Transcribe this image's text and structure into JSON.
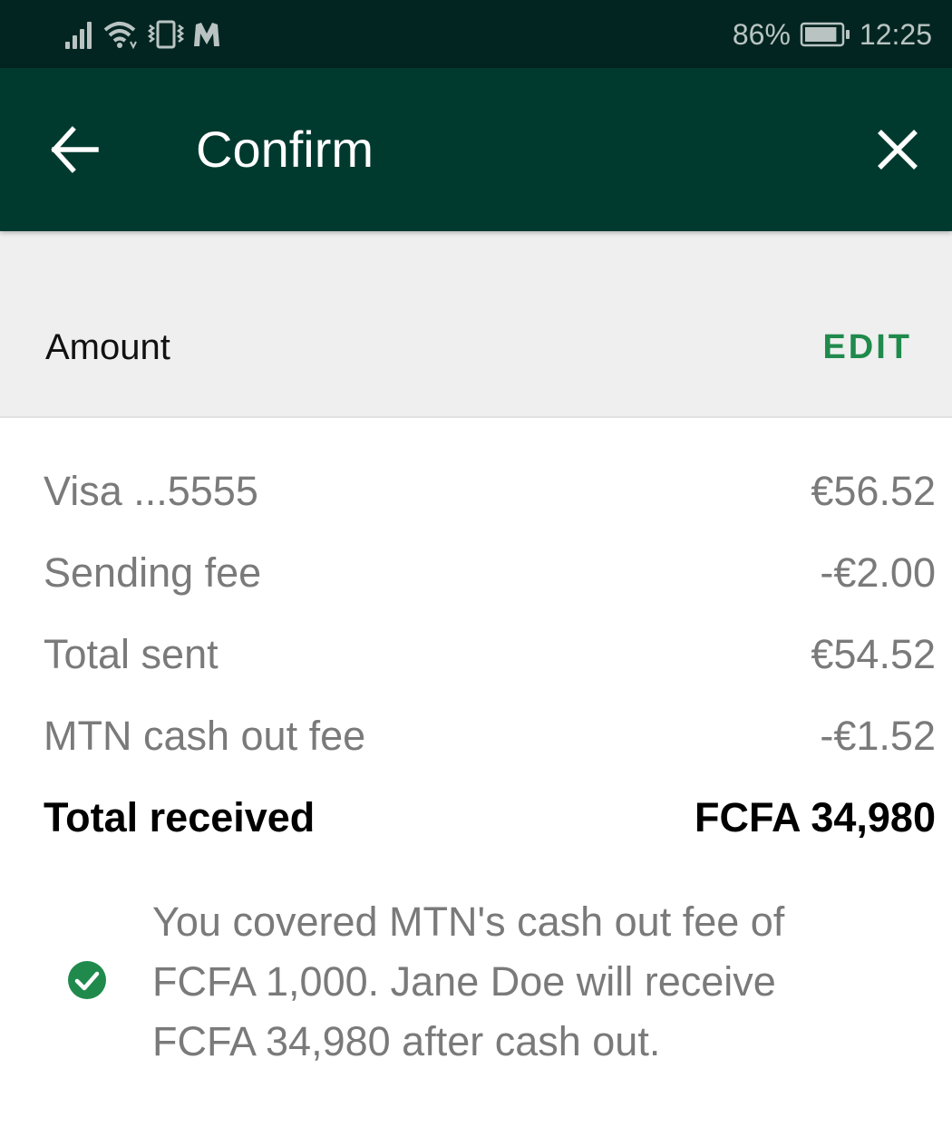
{
  "status_bar": {
    "icons": [
      "signal-icon",
      "wifi-icon",
      "vibrate-icon",
      "m-app-icon"
    ],
    "battery_percent": "86%",
    "battery_level": 0.86,
    "time": "12:25"
  },
  "app_bar": {
    "back_icon": "arrow-left-icon",
    "title": "Confirm",
    "close_icon": "close-icon"
  },
  "amount_section": {
    "label": "Amount",
    "edit_label": "EDIT"
  },
  "breakdown": [
    {
      "label": "Visa ...5555",
      "value": "€56.52"
    },
    {
      "label": "Sending fee",
      "value": "-€2.00"
    },
    {
      "label": "Total sent",
      "value": "€54.52"
    },
    {
      "label": "MTN cash out fee",
      "value": "-€1.52"
    },
    {
      "label": "Total received",
      "value": "FCFA 34,980"
    }
  ],
  "note": {
    "icon": "check-circle-icon",
    "text": "You covered MTN's cash out fee of FCFA 1,000. Jane Doe will receive FCFA 34,980 after cash out."
  },
  "colors": {
    "status_bar_bg": "#022521",
    "app_bar_bg": "#003a2f",
    "accent_green": "#1f8a4c",
    "header_bg": "#efefef",
    "muted_text": "#7a7a7a"
  }
}
